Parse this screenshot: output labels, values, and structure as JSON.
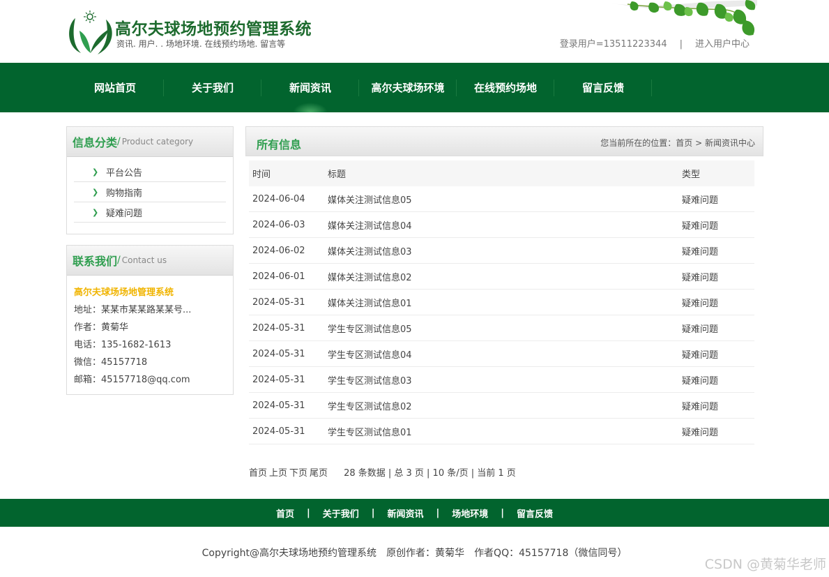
{
  "header": {
    "title": "高尔夫球场地预约管理系统",
    "subtitle": "资讯. 用户. . 场地环境. 在线预约场地. 留言等",
    "login_user": "登录用户=13511223344",
    "separator": "|",
    "user_center": "进入用户中心"
  },
  "nav": {
    "items": [
      {
        "label": "网站首页"
      },
      {
        "label": "关于我们"
      },
      {
        "label": "新闻资讯"
      },
      {
        "label": "高尔夫球场环境"
      },
      {
        "label": "在线预约场地"
      },
      {
        "label": "留言反馈"
      }
    ]
  },
  "category": {
    "title_cn": "信息分类",
    "title_en": "Product category",
    "items": [
      "平台公告",
      "购物指南",
      "疑难问题"
    ]
  },
  "contact": {
    "title_cn": "联系我们",
    "title_en": "Contact us",
    "name": "高尔夫球场场地管理系统",
    "address": "地址：某某市某某路某某号...",
    "author": "作者：黄菊华",
    "phone": "电话：135-1682-1613",
    "wechat": "微信：45157718",
    "email": "邮箱：45157718@qq.com"
  },
  "main": {
    "title": "所有信息",
    "breadcrumb_prefix": "您当前所在的位置：",
    "breadcrumb_home": "首页",
    "breadcrumb_sep": ">",
    "breadcrumb_current": "新闻资讯中心"
  },
  "table": {
    "headers": [
      "时间",
      "标题",
      "类型"
    ],
    "rows": [
      {
        "date": "2024-06-04",
        "title": "媒体关注测试信息05",
        "type": "疑难问题"
      },
      {
        "date": "2024-06-03",
        "title": "媒体关注测试信息04",
        "type": "疑难问题"
      },
      {
        "date": "2024-06-02",
        "title": "媒体关注测试信息03",
        "type": "疑难问题"
      },
      {
        "date": "2024-06-01",
        "title": "媒体关注测试信息02",
        "type": "疑难问题"
      },
      {
        "date": "2024-05-31",
        "title": "媒体关注测试信息01",
        "type": "疑难问题"
      },
      {
        "date": "2024-05-31",
        "title": "学生专区测试信息05",
        "type": "疑难问题"
      },
      {
        "date": "2024-05-31",
        "title": "学生专区测试信息04",
        "type": "疑难问题"
      },
      {
        "date": "2024-05-31",
        "title": "学生专区测试信息03",
        "type": "疑难问题"
      },
      {
        "date": "2024-05-31",
        "title": "学生专区测试信息02",
        "type": "疑难问题"
      },
      {
        "date": "2024-05-31",
        "title": "学生专区测试信息01",
        "type": "疑难问题"
      }
    ]
  },
  "pager": {
    "first": "首页",
    "prev": "上页",
    "next": "下页",
    "last": "尾页",
    "info": "28 条数据 | 总 3 页 | 10 条/页 | 当前 1 页"
  },
  "footer": {
    "links": [
      "首页",
      "关于我们",
      "新闻资讯",
      "场地环境",
      "留言反馈"
    ],
    "separator": "|",
    "copyright": "Copyright@高尔夫球场地预约管理系统",
    "author": "原创作者：黄菊华",
    "qq": "作者QQ：45157718（微信同号）"
  },
  "watermark": "CSDN @黄菊华老师",
  "colors": {
    "brand_green": "#02642e",
    "accent_green": "#2f9e4f",
    "contact_name": "#f0b400"
  },
  "icons": {
    "logo": "leaf-sun-logo-icon",
    "decoration": "green-leaves-icon",
    "category_bullet": "chevron-right-icon"
  }
}
